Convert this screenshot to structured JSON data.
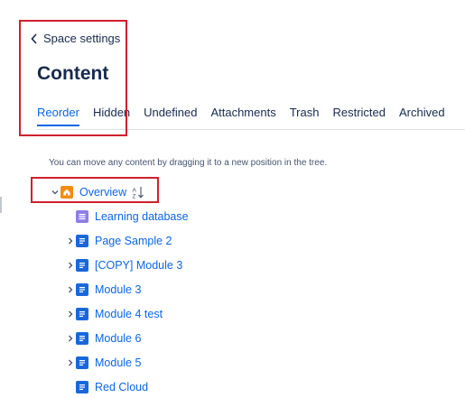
{
  "header": {
    "back_label": "Space settings",
    "title": "Content"
  },
  "tabs": [
    {
      "label": "Reorder",
      "active": true
    },
    {
      "label": "Hidden",
      "active": false
    },
    {
      "label": "Undefined",
      "active": false
    },
    {
      "label": "Attachments",
      "active": false
    },
    {
      "label": "Trash",
      "active": false
    },
    {
      "label": "Restricted",
      "active": false
    },
    {
      "label": "Archived",
      "active": false
    }
  ],
  "hint": "You can move any content by dragging it to a new position in the tree.",
  "tree": {
    "root": {
      "label": "Overview",
      "icon": "home-icon",
      "expanded": true,
      "sort_icon": "sort-alphabetical-icon"
    },
    "items": [
      {
        "label": "Learning database",
        "icon": "database-icon",
        "has_children": false
      },
      {
        "label": "Page Sample 2",
        "icon": "page-icon",
        "has_children": true
      },
      {
        "label": "[COPY] Module 3",
        "icon": "page-icon",
        "has_children": true
      },
      {
        "label": "Module 3",
        "icon": "page-icon",
        "has_children": true
      },
      {
        "label": "Module 4 test",
        "icon": "page-icon",
        "has_children": true
      },
      {
        "label": "Module 6",
        "icon": "page-icon",
        "has_children": true
      },
      {
        "label": "Module 5",
        "icon": "page-icon",
        "has_children": true
      },
      {
        "label": "Red Cloud",
        "icon": "page-icon",
        "has_children": false
      }
    ]
  },
  "colors": {
    "link": "#0c66e4",
    "highlight_box": "#d0202e",
    "home_icon": "#f18d13",
    "database_icon": "#8f7ee7",
    "page_icon": "#1868db"
  }
}
